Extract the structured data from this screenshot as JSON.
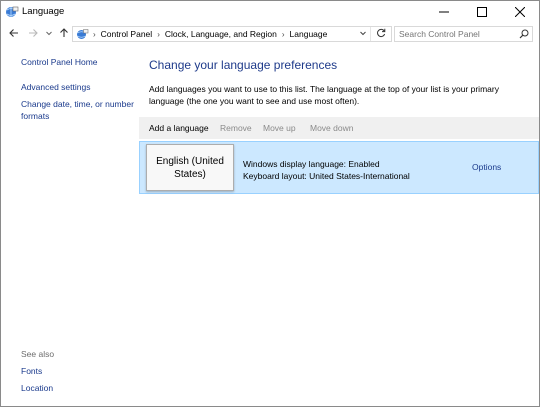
{
  "window": {
    "title": "Language",
    "controls": {
      "minimize": "minimize-icon",
      "maximize": "maximize-icon",
      "close": "close-icon"
    }
  },
  "navigation": {
    "back": "back-arrow-icon",
    "forward": "forward-arrow-icon",
    "recent": "chevron-down-icon",
    "up": "up-arrow-icon",
    "breadcrumbs": [
      "Control Panel",
      "Clock, Language, and Region",
      "Language"
    ],
    "search_placeholder": "Search Control Panel"
  },
  "sidebar": {
    "home": "Control Panel Home",
    "links": [
      "Advanced settings",
      "Change date, time, or number formats"
    ],
    "see_also_label": "See also",
    "see_also_links": [
      "Fonts",
      "Location"
    ]
  },
  "main": {
    "heading": "Change your language preferences",
    "description": "Add languages you want to use to this list. The language at the top of your list is your primary language (the one you want to see and use most often).",
    "toolbar": {
      "add": "Add a language",
      "remove": "Remove",
      "move_up": "Move up",
      "move_down": "Move down"
    },
    "languages": [
      {
        "name": "English (United States)",
        "display_language": "Windows display language: Enabled",
        "keyboard_layout": "Keyboard layout: United States-International",
        "options": "Options"
      }
    ]
  },
  "colors": {
    "link": "#1a3a8c",
    "heading": "#1e3a8a",
    "disabled": "#8a8a8a",
    "selected_row": "#cce8ff",
    "toolbar": "#f0f0f0"
  }
}
